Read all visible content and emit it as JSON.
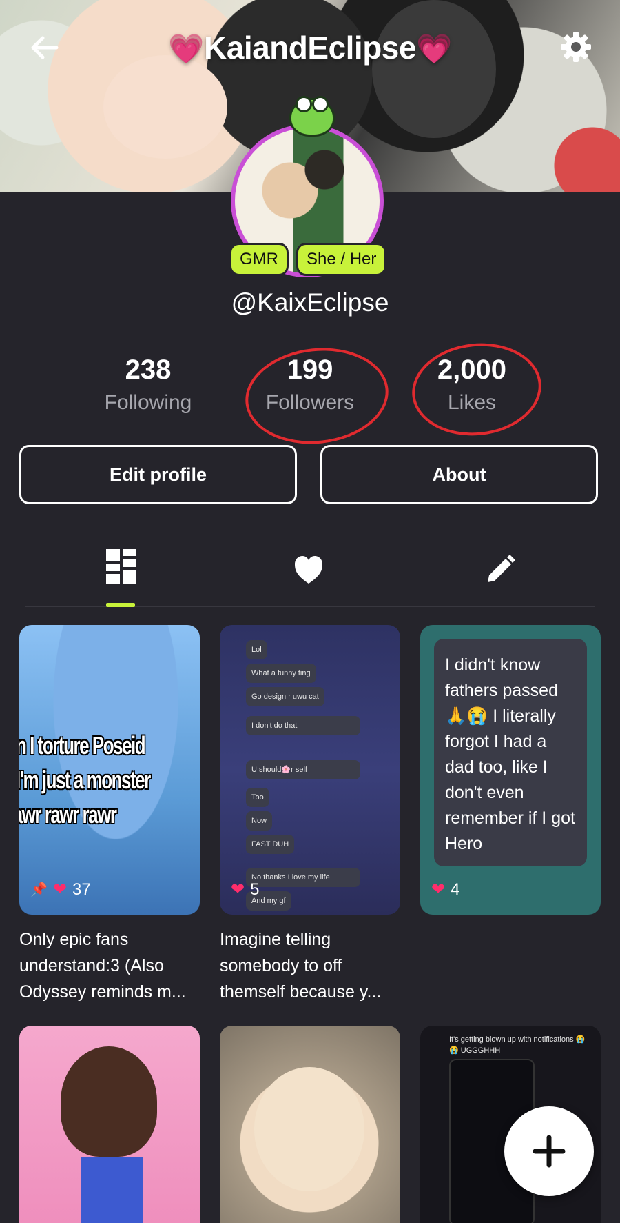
{
  "header": {
    "title": "KaiandEclipse",
    "title_emoji": "💗"
  },
  "profile": {
    "badges": [
      "GMR",
      "She / Her"
    ],
    "handle": "@KaixEclipse"
  },
  "stats": [
    {
      "value": "238",
      "label": "Following"
    },
    {
      "value": "199",
      "label": "Followers"
    },
    {
      "value": "2,000",
      "label": "Likes"
    }
  ],
  "buttons": {
    "edit": "Edit profile",
    "about": "About"
  },
  "tabs": [
    "grid-icon",
    "heart-icon",
    "pencil-icon"
  ],
  "posts": [
    {
      "meme_lines": [
        "en I torture Poseid",
        "t I'm just a monster",
        "rawr rawr rawr"
      ],
      "likes": "37",
      "caption": [
        "Only epic fans",
        "understand:3 (Also",
        "Odyssey reminds m..."
      ]
    },
    {
      "chat": [
        "Lol",
        "What a funny ting",
        "Go design r uwu cat",
        "I don't do that",
        "U should🌸r self",
        "Too",
        "Now",
        "FAST DUH",
        "No thanks I love my life",
        "And my gf"
      ],
      "likes": "5",
      "caption": [
        "Imagine telling",
        "somebody to off",
        "themself because y..."
      ]
    },
    {
      "note": "I didn't know fathers passed 🙏😭 I literally forgot I had a dad too, like I don't even remember if I got Hero",
      "likes": "4"
    },
    {},
    {},
    {
      "text": "It's getting blown up with notifications 😭😭 UGGGHHH"
    }
  ],
  "colors": {
    "accent": "#c8f23a",
    "background": "#25242b",
    "annotation": "#e02a2f",
    "heart": "#ff2d6b"
  }
}
